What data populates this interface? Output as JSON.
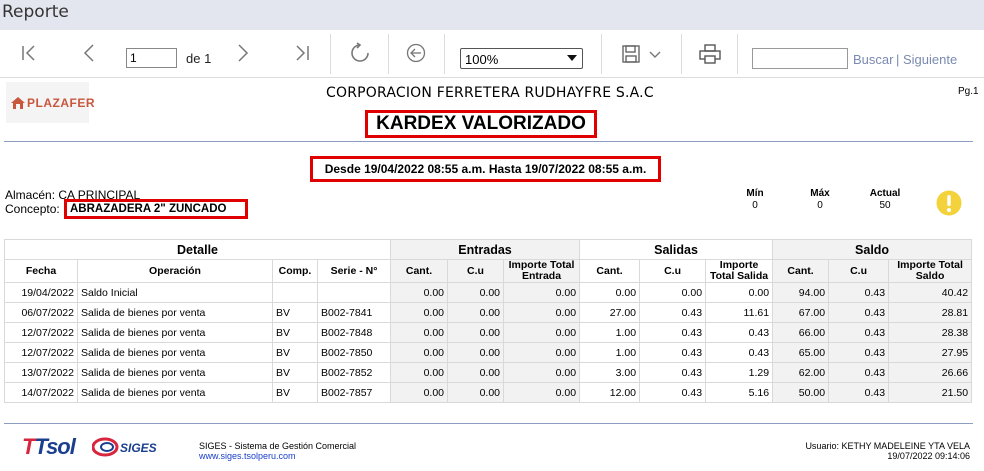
{
  "window": {
    "title": "Reporte"
  },
  "toolbar": {
    "page_value": "1",
    "page_of": "de 1",
    "zoom_value": "100%",
    "search_placeholder": "",
    "search_label": "Buscar",
    "separator": "|",
    "next_label": "Siguiente"
  },
  "report": {
    "logo_text": "PLAZAFER",
    "company": "CORPORACION FERRETERA RUDHAYFRE S.A.C",
    "page_indicator": "Pg.1",
    "title": "KARDEX VALORIZADO",
    "date_range": "Desde  19/04/2022 08:55 a.m. Hasta 19/07/2022 08:55 a.m.",
    "almacen": "Almacén: CA PRINCIPAL",
    "concepto_label": "Concepto:",
    "concepto_value": "ABRAZADERA 2\" ZUNCADO",
    "stats": {
      "min_label": "Mín",
      "min_value": "0",
      "max_label": "Máx",
      "max_value": "0",
      "actual_label": "Actual",
      "actual_value": "50"
    },
    "accent": "#e00000"
  },
  "table": {
    "groups": [
      "Detalle",
      "Entradas",
      "Salidas",
      "Saldo"
    ],
    "headers": [
      "Fecha",
      "Operación",
      "Comp.",
      "Serie - N°",
      "Cant.",
      "C.u",
      "Importe Total Entrada",
      "Cant.",
      "C.u",
      "Importe Total Salida",
      "Cant.",
      "C.u",
      "Importe Total Saldo"
    ],
    "rows": [
      [
        "19/04/2022",
        "Saldo Inicial",
        "",
        "",
        "0.00",
        "0.00",
        "0.00",
        "0.00",
        "0.00",
        "0.00",
        "94.00",
        "0.43",
        "40.42"
      ],
      [
        "06/07/2022",
        "Salida de bienes por venta",
        "BV",
        "B002-7841",
        "0.00",
        "0.00",
        "0.00",
        "27.00",
        "0.43",
        "11.61",
        "67.00",
        "0.43",
        "28.81"
      ],
      [
        "12/07/2022",
        "Salida de bienes por venta",
        "BV",
        "B002-7848",
        "0.00",
        "0.00",
        "0.00",
        "1.00",
        "0.43",
        "0.43",
        "66.00",
        "0.43",
        "28.38"
      ],
      [
        "12/07/2022",
        "Salida de bienes por venta",
        "BV",
        "B002-7850",
        "0.00",
        "0.00",
        "0.00",
        "1.00",
        "0.43",
        "0.43",
        "65.00",
        "0.43",
        "27.95"
      ],
      [
        "13/07/2022",
        "Salida de bienes por venta",
        "BV",
        "B002-7852",
        "0.00",
        "0.00",
        "0.00",
        "3.00",
        "0.43",
        "1.29",
        "62.00",
        "0.43",
        "26.66"
      ],
      [
        "14/07/2022",
        "Salida de bienes por venta",
        "BV",
        "B002-7857",
        "0.00",
        "0.00",
        "0.00",
        "12.00",
        "0.43",
        "5.16",
        "50.00",
        "0.43",
        "21.50"
      ]
    ]
  },
  "footer": {
    "brand1": "Tsol",
    "brand2": "SIGES",
    "system": "SIGES - Sistema de Gestión Comercial",
    "url": "www.siges.tsolperu.com",
    "user": "Usuario: KETHY MADELEINE YTA VELA",
    "datetime": "19/07/2022 09:14:06"
  },
  "icons": [
    "first-page-icon",
    "prev-page-icon",
    "next-page-icon",
    "last-page-icon",
    "refresh-icon",
    "back-icon",
    "save-icon",
    "dropdown-icon",
    "print-icon",
    "warning-icon"
  ]
}
